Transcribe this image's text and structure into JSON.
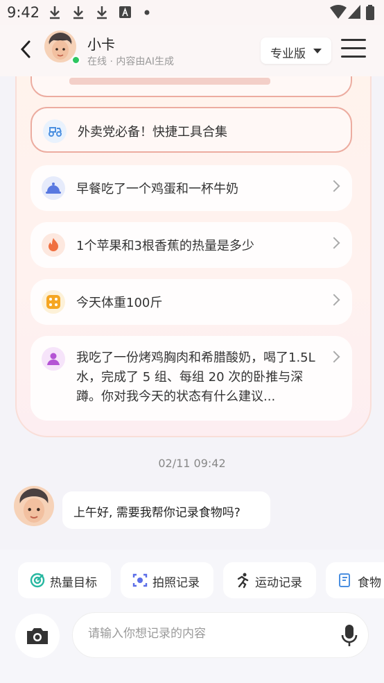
{
  "status_bar": {
    "time": "9:42"
  },
  "header": {
    "name": "小卡",
    "subtitle": "在线 · 内容由AI生成",
    "version_label": "专业版"
  },
  "suggestions": [
    {
      "text": "外卖党必备！快捷工具合集",
      "icon": "scooter-icon",
      "highlighted": true
    },
    {
      "text": "早餐吃了一个鸡蛋和一杯牛奶",
      "icon": "food-cover-icon"
    },
    {
      "text": "1个苹果和3根香蕉的热量是多少",
      "icon": "flame-icon"
    },
    {
      "text": "今天体重100斤",
      "icon": "dice-icon"
    },
    {
      "text": "我吃了一份烤鸡胸肉和希腊酸奶，喝了1.5L水，完成了 5 组、每组 20 次的卧推与深蹲。你对我今天的状态有什么建议...",
      "icon": "person-icon"
    }
  ],
  "chat": {
    "timestamp": "02/11 09:42",
    "message": "上午好, 需要我帮你记录食物吗?"
  },
  "quick_actions": [
    {
      "label": "热量目标",
      "icon": "target-icon"
    },
    {
      "label": "拍照记录",
      "icon": "scan-camera-icon"
    },
    {
      "label": "运动记录",
      "icon": "running-icon"
    },
    {
      "label": "食物",
      "icon": "note-icon"
    }
  ],
  "composer": {
    "placeholder": "请输入你想记录的内容"
  },
  "colors": {
    "accent": "#f0a090",
    "online": "#2dc660"
  }
}
